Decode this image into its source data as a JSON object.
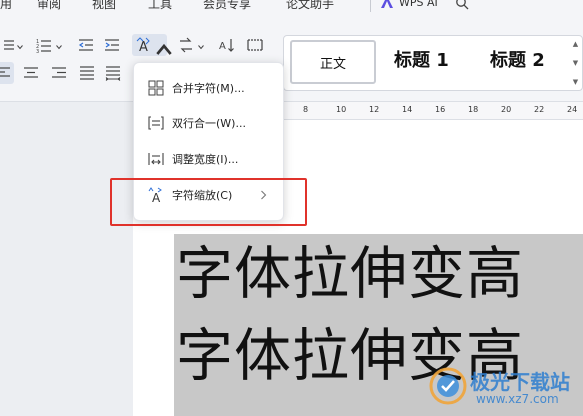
{
  "menubar": {
    "items": [
      {
        "label": "用"
      },
      {
        "label": "审阅"
      },
      {
        "label": "视图"
      },
      {
        "label": "工具"
      },
      {
        "label": "会员专享"
      },
      {
        "label": "论文助手"
      }
    ],
    "wps_ai": "WPS AI"
  },
  "styles": {
    "normal": "正文",
    "heading1": "标题 1",
    "heading2": "标题 2"
  },
  "ruler": {
    "ticks": [
      "8",
      "10",
      "12",
      "14",
      "16",
      "18",
      "20",
      "22",
      "24"
    ]
  },
  "dropdown": {
    "items": [
      {
        "label": "合并字符(M)...",
        "icon": "combine-characters-icon"
      },
      {
        "label": "双行合一(W)...",
        "icon": "two-lines-in-one-icon"
      },
      {
        "label": "调整宽度(I)...",
        "icon": "adjust-width-icon"
      },
      {
        "label": "字符缩放(C)",
        "icon": "character-scale-icon",
        "has_submenu": true
      }
    ]
  },
  "document": {
    "lines": [
      "字体拉伸变高",
      "字体拉伸变高"
    ]
  },
  "watermark": {
    "title": "极光下载站",
    "url": "www.xz7.com"
  },
  "colors": {
    "highlight_box": "#e0322b",
    "selection": "#c8c8c8"
  }
}
